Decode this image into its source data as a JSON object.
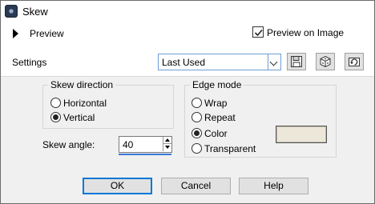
{
  "window": {
    "title": "Skew",
    "icon": "psp-app-icon"
  },
  "preview": {
    "label": "Preview",
    "preview_on_image_label": "Preview on Image",
    "preview_on_image_checked": true
  },
  "settings": {
    "label": "Settings",
    "preset_value": "Last Used"
  },
  "skew_direction": {
    "title": "Skew direction",
    "options": [
      {
        "label": "Horizontal",
        "selected": false
      },
      {
        "label": "Vertical",
        "selected": true
      }
    ]
  },
  "skew_angle": {
    "label": "Skew angle:",
    "value": "40"
  },
  "edge_mode": {
    "title": "Edge mode",
    "options": [
      {
        "label": "Wrap",
        "selected": false
      },
      {
        "label": "Repeat",
        "selected": false
      },
      {
        "label": "Color",
        "selected": true
      },
      {
        "label": "Transparent",
        "selected": false
      }
    ],
    "color": "#ece7d8"
  },
  "buttons": {
    "ok": "OK",
    "cancel": "Cancel",
    "help": "Help"
  }
}
